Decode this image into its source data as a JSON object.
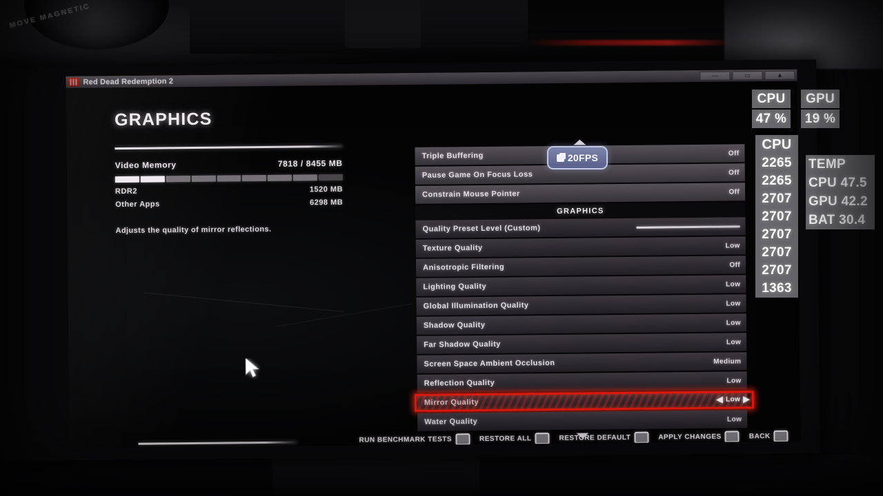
{
  "window": {
    "title": "Red Dead Redemption 2",
    "icon": "rdr2-app-icon",
    "controls": [
      {
        "name": "minimize-button",
        "glyph": "—"
      },
      {
        "name": "maximize-button",
        "glyph": "▭"
      },
      {
        "name": "collapse-button",
        "glyph": "▲"
      }
    ]
  },
  "left_panel": {
    "page_title": "GRAPHICS",
    "video_memory": {
      "label": "Video Memory",
      "value": "7818 / 8455 MB"
    },
    "breakdown": [
      {
        "label": "RDR2",
        "value": "1520 MB"
      },
      {
        "label": "Other Apps",
        "value": "6298 MB"
      }
    ],
    "description": "Adjusts the quality of mirror reflections."
  },
  "settings": {
    "top_rows": [
      {
        "label": "Triple Buffering",
        "value": "Off"
      },
      {
        "label": "Pause Game On Focus Loss",
        "value": "Off"
      },
      {
        "label": "Constrain Mouse Pointer",
        "value": "Off"
      }
    ],
    "section_header": "GRAPHICS",
    "graphics_rows": [
      {
        "label": "Quality Preset Level  (Custom)",
        "value": "",
        "control": "slider"
      },
      {
        "label": "Texture Quality",
        "value": "Low"
      },
      {
        "label": "Anisotropic Filtering",
        "value": "Off"
      },
      {
        "label": "Lighting Quality",
        "value": "Low"
      },
      {
        "label": "Global Illumination Quality",
        "value": "Low"
      },
      {
        "label": "Shadow Quality",
        "value": "Low"
      },
      {
        "label": "Far Shadow Quality",
        "value": "Low"
      },
      {
        "label": "Screen Space Ambient Occlusion",
        "value": "Medium"
      },
      {
        "label": "Reflection Quality",
        "value": "Low"
      },
      {
        "label": "Mirror Quality",
        "value": "Low",
        "selected": true
      },
      {
        "label": "Water Quality",
        "value": "Low"
      }
    ],
    "selected_value": "Low",
    "arrow_left": "◀",
    "arrow_right": "▶",
    "highlight_color": "#f21c10"
  },
  "fps_overlay": {
    "label": "20FPS",
    "icon": "frame-counter-icon",
    "color": "#6a7292"
  },
  "buttons": [
    {
      "label": "Run Benchmark Tests",
      "key": "name-run-benchmark"
    },
    {
      "label": "Restore All",
      "key": "name-restore-all"
    },
    {
      "label": "Restore Default",
      "key": "name-restore-default"
    },
    {
      "label": "Apply Changes",
      "key": "name-apply-changes"
    },
    {
      "label": "Back",
      "key": "name-back"
    }
  ],
  "hud": {
    "cpu_usage": {
      "title": "CPU",
      "value": "47 %"
    },
    "gpu_usage": {
      "title": "GPU",
      "value": "19 %"
    },
    "cpu_clocks": {
      "title": "CPU",
      "values": [
        "2265",
        "2265",
        "2707",
        "2707",
        "2707",
        "2707",
        "2707",
        "1363"
      ]
    },
    "temps": {
      "title": "TEMP",
      "rows": [
        "CPU 47.5",
        "GPU 42.2",
        "BAT 30.4"
      ]
    }
  },
  "environment": {
    "lens_text": "MOVE MAGNETIC"
  }
}
